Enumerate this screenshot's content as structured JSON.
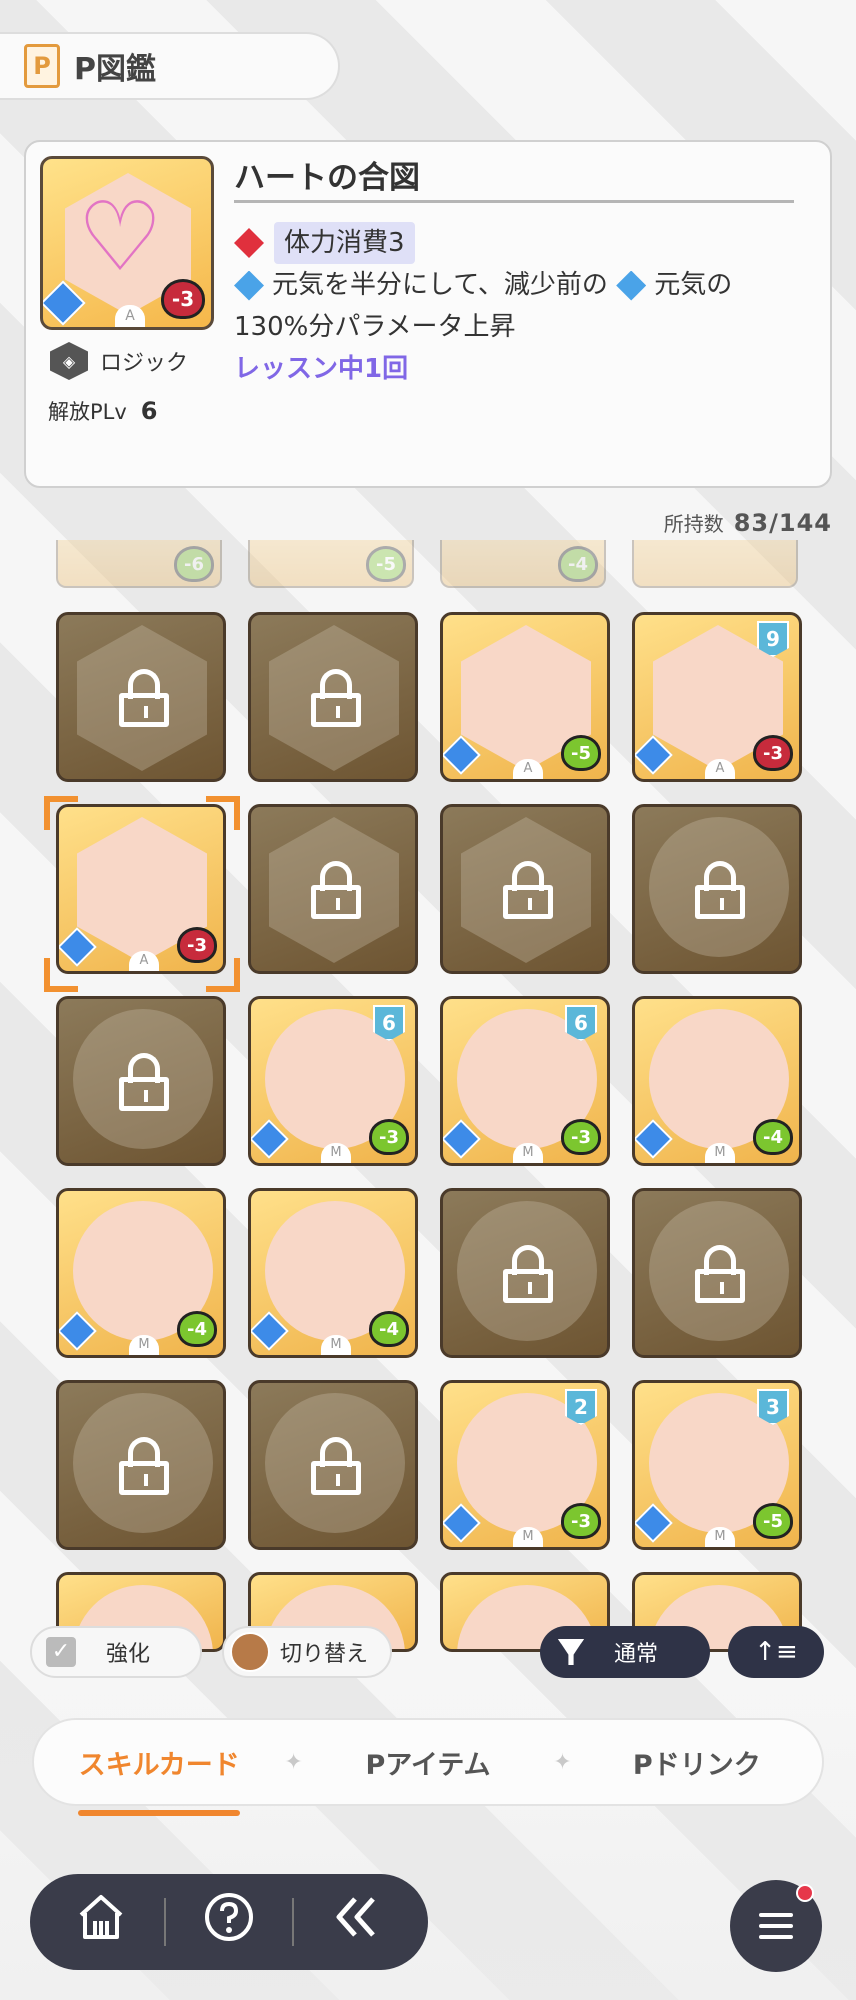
{
  "header": {
    "icon": "book-p-icon",
    "icon_text": "P",
    "title": "P図鑑"
  },
  "detail": {
    "name": "ハートの合図",
    "cost_badge": "-3",
    "rank": "A",
    "plan": "ロジック",
    "unlock_label": "解放PLv",
    "unlock_value": "6",
    "effect1": "体力消費3",
    "effect2_a": "元気を半分にして、減少前の",
    "effect2_b": "元気の",
    "effect2_c": "130%分パラメータ上昇",
    "effect3": "レッスン中1回"
  },
  "owned": {
    "label": "所持数",
    "value": "83/144"
  },
  "partial_row": [
    "-6",
    "-5",
    "-4",
    ""
  ],
  "tiles": [
    {
      "locked": true,
      "shape": "hex"
    },
    {
      "locked": true,
      "shape": "hex"
    },
    {
      "locked": false,
      "shape": "hex",
      "badge": "-5",
      "badge_color": "green",
      "rank": "A"
    },
    {
      "locked": false,
      "shape": "hex",
      "badge": "-3",
      "badge_color": "red",
      "level": "9",
      "rank": "A"
    },
    {
      "locked": false,
      "shape": "hex",
      "badge": "-3",
      "badge_color": "red",
      "rank": "A",
      "selected": true
    },
    {
      "locked": true,
      "shape": "hex"
    },
    {
      "locked": true,
      "shape": "hex"
    },
    {
      "locked": true,
      "shape": "circle"
    },
    {
      "locked": true,
      "shape": "circle"
    },
    {
      "locked": false,
      "shape": "circle",
      "badge": "-3",
      "badge_color": "green",
      "level": "6",
      "rank": "M"
    },
    {
      "locked": false,
      "shape": "circle",
      "badge": "-3",
      "badge_color": "green",
      "level": "6",
      "rank": "M"
    },
    {
      "locked": false,
      "shape": "circle",
      "badge": "-4",
      "badge_color": "green",
      "rank": "M"
    },
    {
      "locked": false,
      "shape": "circle",
      "badge": "-4",
      "badge_color": "green",
      "rank": "M"
    },
    {
      "locked": false,
      "shape": "circle",
      "badge": "-4",
      "badge_color": "green",
      "rank": "M"
    },
    {
      "locked": true,
      "shape": "circle"
    },
    {
      "locked": true,
      "shape": "circle"
    },
    {
      "locked": true,
      "shape": "circle"
    },
    {
      "locked": true,
      "shape": "circle"
    },
    {
      "locked": false,
      "shape": "circle",
      "badge": "-3",
      "badge_color": "green",
      "level": "2",
      "rank": "M"
    },
    {
      "locked": false,
      "shape": "circle",
      "badge": "-5",
      "badge_color": "green",
      "level": "3",
      "rank": "M"
    },
    {
      "locked": false,
      "shape": "circle"
    },
    {
      "locked": false,
      "shape": "circle"
    },
    {
      "locked": false,
      "shape": "circle"
    },
    {
      "locked": false,
      "shape": "circle"
    }
  ],
  "toolbar": {
    "enhance_label": "強化",
    "switch_label": "切り替え",
    "filter_label": "通常",
    "sort_icon": "sort-ascending-icon"
  },
  "tabs": [
    "スキルカード",
    "Pアイテム",
    "Pドリンク"
  ],
  "tab_separator": "✦",
  "nav": {
    "home_icon": "home-icon",
    "help_icon": "help-icon",
    "back_icon": "back-icon",
    "menu_icon": "menu-icon"
  },
  "colors": {
    "accent": "#f0862e",
    "dark": "#3a3c4a",
    "effect_purple": "#8067e6"
  }
}
